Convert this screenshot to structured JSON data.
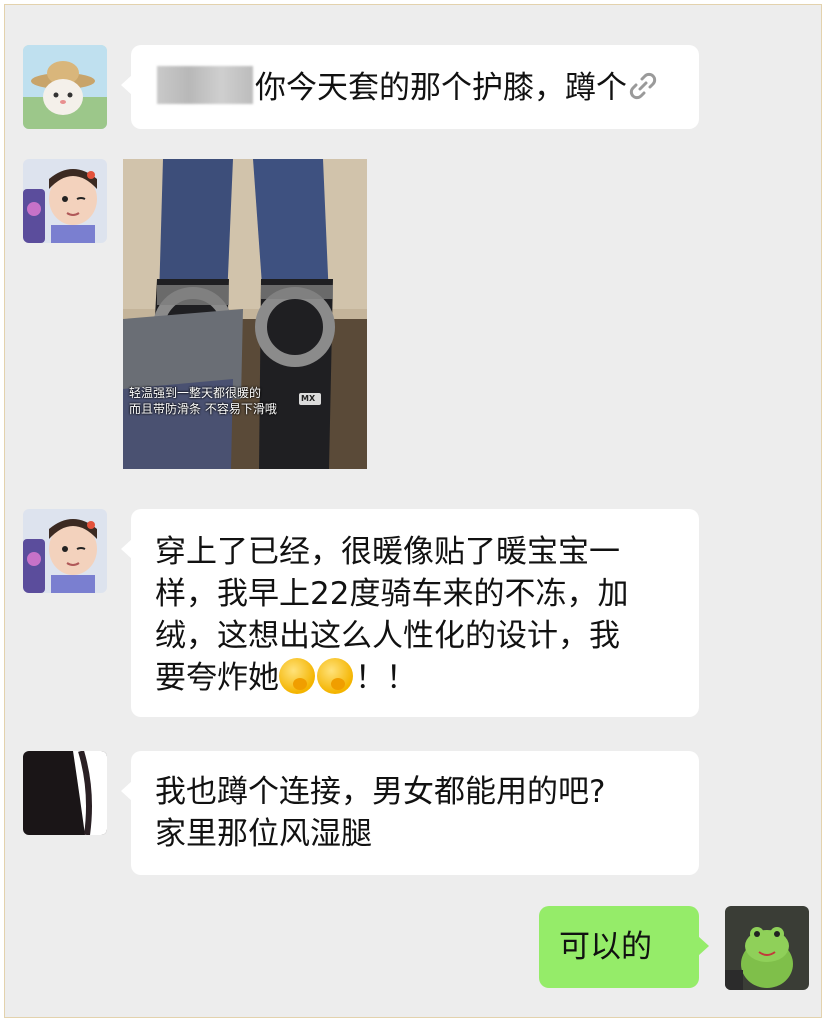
{
  "messages": [
    {
      "side": "left",
      "avatar": "cat-avatar",
      "text_after_redaction": "你今天套的那个护膝，蹲个",
      "icon": "link-icon"
    },
    {
      "side": "left",
      "avatar": "girl-avatar",
      "type": "image",
      "image_caption": [
        "轻温强到一整天都很暖的",
        "而且带防滑条 不容易下滑哦"
      ],
      "brand_mark": "MX"
    },
    {
      "side": "left",
      "avatar": "girl-avatar",
      "lines": [
        "穿上了已经，很暖像贴了暖宝宝一",
        "样，我早上22度骑车来的不冻，加",
        "绒，这想出这么人性化的设计，我"
      ],
      "last_line_start": "要夸炸她",
      "last_line_end": "！！"
    },
    {
      "side": "left",
      "avatar": "dark-avatar",
      "lines": [
        "我也蹲个连接，男女都能用的吧?",
        "家里那位风湿腿"
      ]
    },
    {
      "side": "right",
      "avatar": "frog-avatar",
      "text": "可以的"
    }
  ],
  "colors": {
    "background": "#ededed",
    "bubble_left": "#ffffff",
    "bubble_right": "#95ec69"
  }
}
